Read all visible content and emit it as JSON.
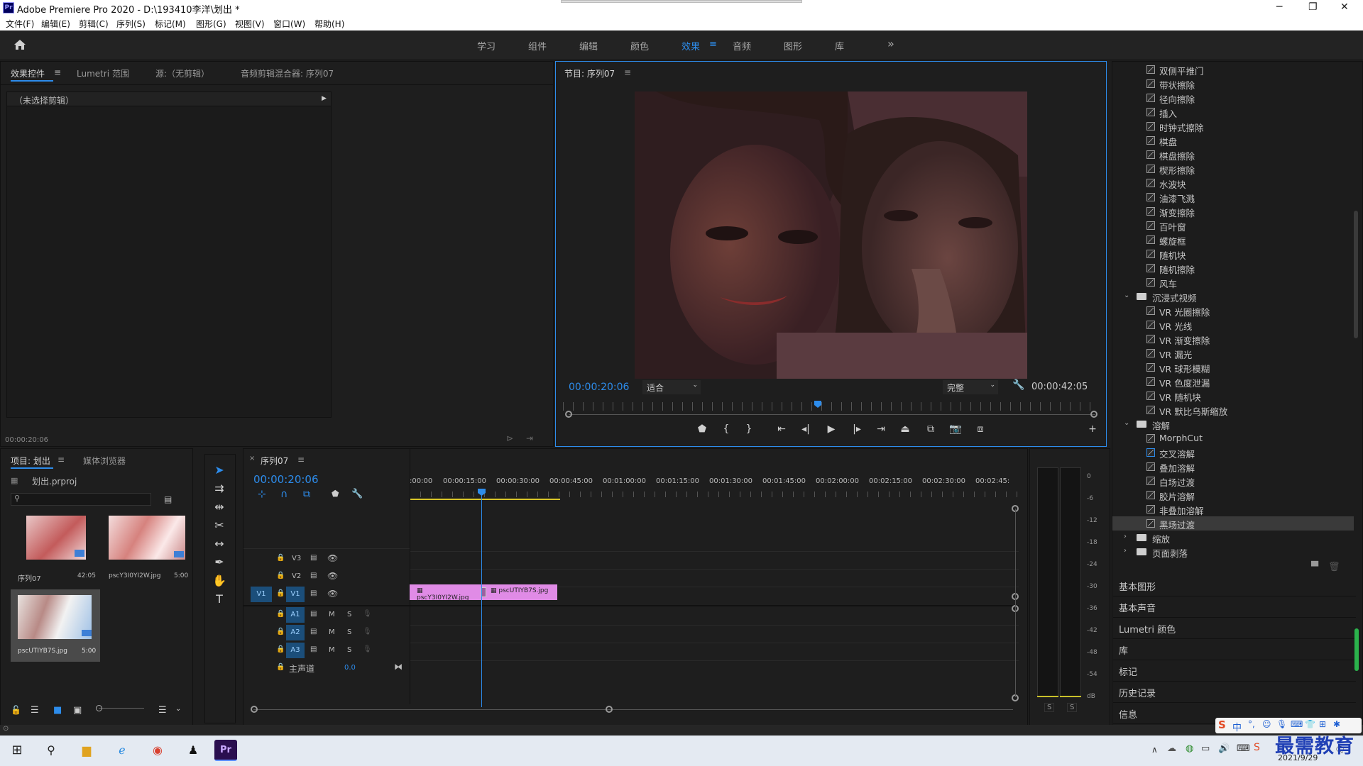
{
  "window": {
    "title": "Adobe Premiere Pro 2020 - D:\\193410李洋\\划出 *",
    "app_icon": "Pr"
  },
  "menu": [
    "文件(F)",
    "编辑(E)",
    "剪辑(C)",
    "序列(S)",
    "标记(M)",
    "图形(G)",
    "视图(V)",
    "窗口(W)",
    "帮助(H)"
  ],
  "workspaces": [
    "学习",
    "组件",
    "编辑",
    "颜色",
    "效果",
    "音频",
    "图形",
    "库"
  ],
  "active_workspace": "效果",
  "more_label": "»",
  "source_panel": {
    "tabs": [
      "效果控件",
      "Lumetri 范围",
      "源:（无剪辑）",
      "音频剪辑混合器: 序列07"
    ],
    "no_clip": "（未选择剪辑）",
    "timecode": "00:00:20:06"
  },
  "program_panel": {
    "title": "节目: 序列07",
    "timecode": "00:00:20:06",
    "fit": "适合",
    "quality": "完整",
    "duration": "00:00:42:05"
  },
  "effects": {
    "items": [
      {
        "label": "双侧平推门",
        "type": "item"
      },
      {
        "label": "带状擦除",
        "type": "item"
      },
      {
        "label": "径向擦除",
        "type": "item"
      },
      {
        "label": "插入",
        "type": "item"
      },
      {
        "label": "时钟式擦除",
        "type": "item"
      },
      {
        "label": "棋盘",
        "type": "item"
      },
      {
        "label": "棋盘擦除",
        "type": "item"
      },
      {
        "label": "楔形擦除",
        "type": "item"
      },
      {
        "label": "水波块",
        "type": "item"
      },
      {
        "label": "油漆飞溅",
        "type": "item"
      },
      {
        "label": "渐变擦除",
        "type": "item"
      },
      {
        "label": "百叶窗",
        "type": "item"
      },
      {
        "label": "螺旋框",
        "type": "item"
      },
      {
        "label": "随机块",
        "type": "item"
      },
      {
        "label": "随机擦除",
        "type": "item"
      },
      {
        "label": "风车",
        "type": "item"
      },
      {
        "label": "沉浸式视频",
        "type": "folder",
        "open": true
      },
      {
        "label": "VR 光圈擦除",
        "type": "item"
      },
      {
        "label": "VR 光线",
        "type": "item"
      },
      {
        "label": "VR 渐变擦除",
        "type": "item"
      },
      {
        "label": "VR 漏光",
        "type": "item"
      },
      {
        "label": "VR 球形模糊",
        "type": "item"
      },
      {
        "label": "VR 色度泄漏",
        "type": "item"
      },
      {
        "label": "VR 随机块",
        "type": "item"
      },
      {
        "label": "VR 默比乌斯缩放",
        "type": "item"
      },
      {
        "label": "溶解",
        "type": "folder",
        "open": true
      },
      {
        "label": "MorphCut",
        "type": "item"
      },
      {
        "label": "交叉溶解",
        "type": "item"
      },
      {
        "label": "叠加溶解",
        "type": "item"
      },
      {
        "label": "白场过渡",
        "type": "item"
      },
      {
        "label": "胶片溶解",
        "type": "item"
      },
      {
        "label": "非叠加溶解",
        "type": "item"
      },
      {
        "label": "黑场过渡",
        "type": "item",
        "selected": true
      },
      {
        "label": "缩放",
        "type": "folder",
        "open": false
      },
      {
        "label": "页面剥落",
        "type": "folder",
        "open": false
      }
    ],
    "stack": [
      "基本图形",
      "基本声音",
      "Lumetri 颜色",
      "库",
      "标记",
      "历史记录",
      "信息"
    ]
  },
  "project": {
    "tabs": [
      "项目: 划出",
      "媒体浏览器"
    ],
    "file": "划出.prproj",
    "items": [
      {
        "name": "序列07",
        "duration": "42:05"
      },
      {
        "name": "pscY3I0YI2W.jpg",
        "duration": "5:00"
      },
      {
        "name": "pscUTIYB7S.jpg",
        "duration": "5:00"
      }
    ]
  },
  "timeline": {
    "tab": "序列07",
    "timecode": "00:00:20:06",
    "ruler": [
      ":00:00",
      "00:00:15:00",
      "00:00:30:00",
      "00:00:45:00",
      "00:01:00:00",
      "00:01:15:00",
      "00:01:30:00",
      "00:01:45:00",
      "00:02:00:00",
      "00:02:15:00",
      "00:02:30:00",
      "00:02:45:"
    ],
    "video_tracks": [
      "V3",
      "V2",
      "V1"
    ],
    "audio_tracks": [
      "A1",
      "A2",
      "A3"
    ],
    "source_patch": "V1",
    "mute": "M",
    "solo": "S",
    "master_label": "主声道",
    "master_value": "0.0",
    "clips": [
      "pscY3I0YI2W.jpg",
      "pscUTIYB7S.jpg"
    ]
  },
  "meter": {
    "ticks": [
      "0",
      "-6",
      "-12",
      "-18",
      "-24",
      "-30",
      "-36",
      "-42",
      "-48",
      "-54",
      "dB"
    ],
    "solo": [
      "S",
      "S"
    ]
  },
  "taskbar": {
    "time": "",
    "date": "2021/9/29",
    "watermark": "最需教育",
    "ime": "中"
  }
}
